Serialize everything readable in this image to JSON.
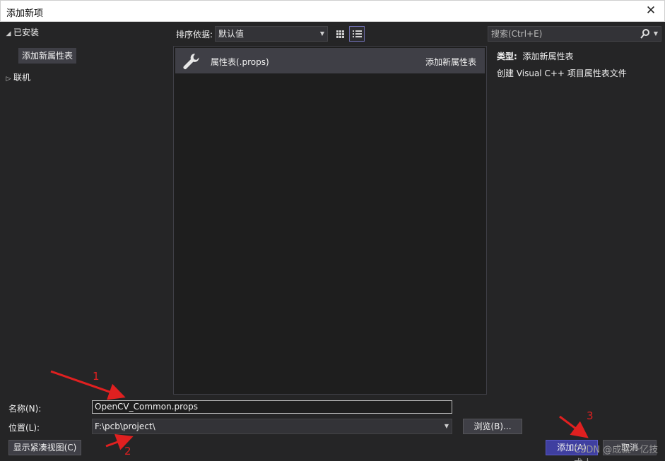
{
  "window": {
    "title": "添加新项",
    "close_glyph": "✕"
  },
  "left_tree": {
    "installed": "已安装",
    "selected_item": "添加新属性表",
    "online": "联机"
  },
  "toolbar": {
    "sort_label": "排序依据:",
    "sort_value": "默认值",
    "search_placeholder": "搜索(Ctrl+E)"
  },
  "items": [
    {
      "name": "属性表(.props)",
      "category": "添加新属性表",
      "icon": "wrench-icon"
    }
  ],
  "details": {
    "type_key": "类型:",
    "type_value": "添加新属性表",
    "description": "创建 Visual C++ 项目属性表文件"
  },
  "form": {
    "name_label": "名称(N):",
    "name_value": "OpenCV_Common.props",
    "location_label": "位置(L):",
    "location_value": "F:\\pcb\\project\\",
    "browse_label": "浏览(B)...",
    "compact_label": "显示紧凑视图(C)",
    "add_label": "添加(A)",
    "cancel_label": "取消"
  },
  "annotations": [
    "1",
    "2",
    "3"
  ],
  "watermark": "CSDN @成就一亿技术人"
}
